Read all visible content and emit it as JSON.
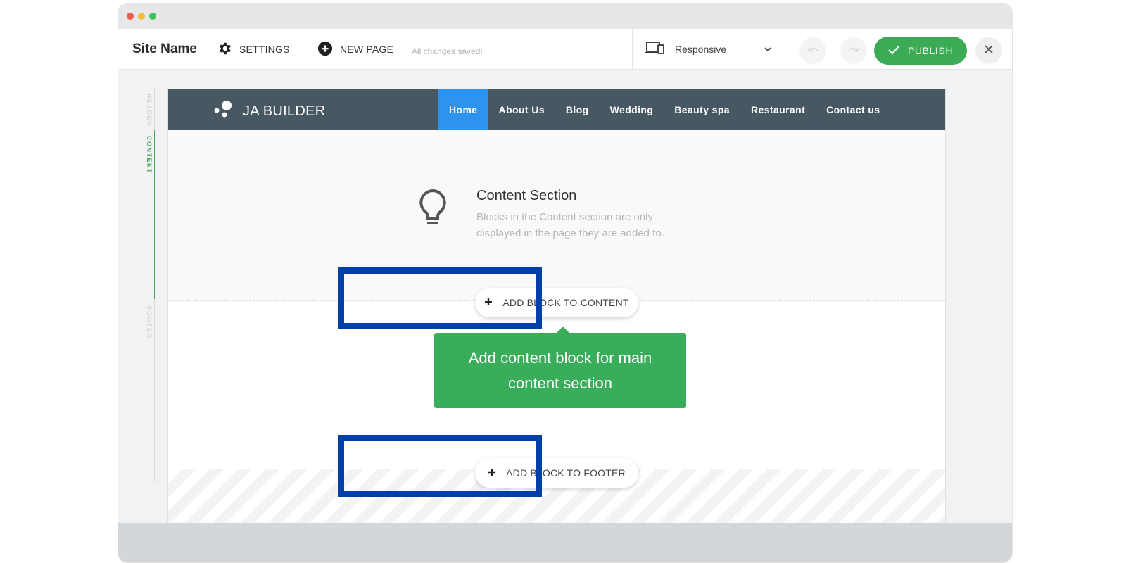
{
  "toolbar": {
    "site_name": "Site Name",
    "settings_label": "SETTINGS",
    "new_page_label": "NEW PAGE",
    "saved_status": "All changes saved!",
    "view_mode": "Responsive",
    "publish_label": "PUBLISH"
  },
  "side_rail": {
    "header": "HEADER",
    "content": "CONTENT",
    "footer": "FOOTER"
  },
  "site": {
    "logo_text": "JA BUILDER",
    "nav": [
      {
        "label": "Home",
        "active": true
      },
      {
        "label": "About Us"
      },
      {
        "label": "Blog"
      },
      {
        "label": "Wedding"
      },
      {
        "label": "Beauty spa"
      },
      {
        "label": "Restaurant"
      },
      {
        "label": "Contact us"
      }
    ]
  },
  "content_section": {
    "title": "Content Section",
    "description": "Blocks in the Content section are only displayed in the page they are added to."
  },
  "buttons": {
    "add_content": "ADD BLOCK TO CONTENT",
    "add_footer": "ADD BLOCK TO FOOTER"
  },
  "tooltip": {
    "text": "Add content block for main content section"
  },
  "colors": {
    "publish": "#3cab55",
    "nav_bg": "#475863",
    "nav_active": "#2c94ef",
    "tooltip": "#39ad5a",
    "highlight": "#0040a8"
  }
}
